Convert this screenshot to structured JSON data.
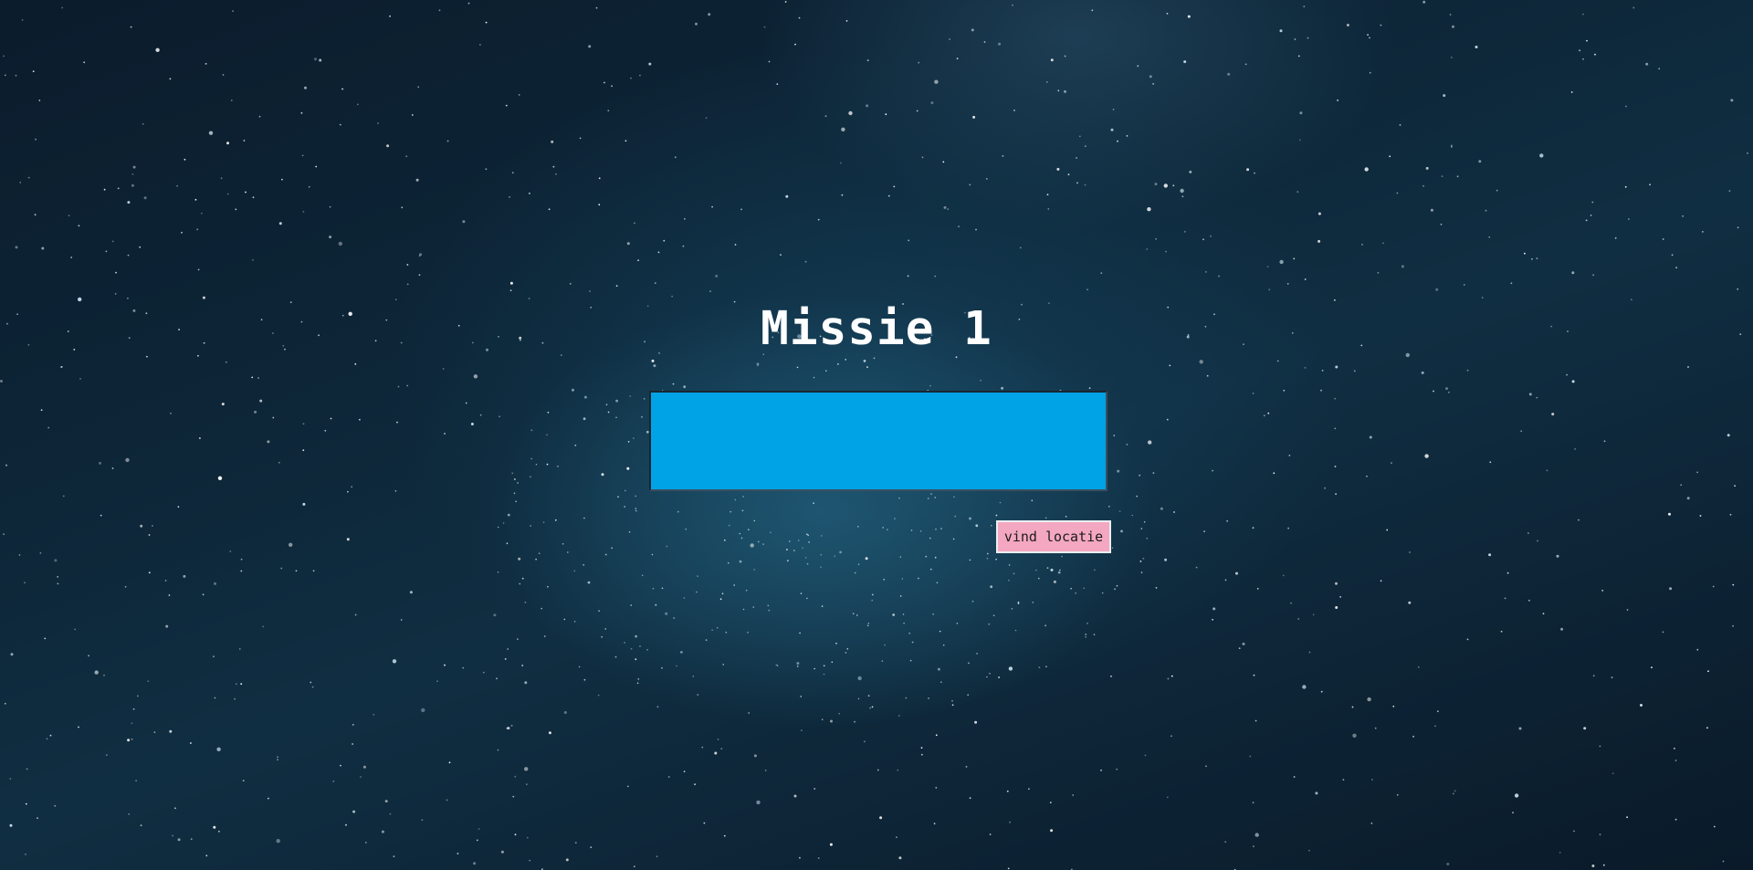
{
  "page": {
    "title": "Missie 1"
  },
  "mission": {
    "input_value": "",
    "button_label": "vind locatie"
  },
  "colors": {
    "input_background": "#00a3e6",
    "button_background": "#f4a7c1",
    "title_text": "#ffffff"
  }
}
